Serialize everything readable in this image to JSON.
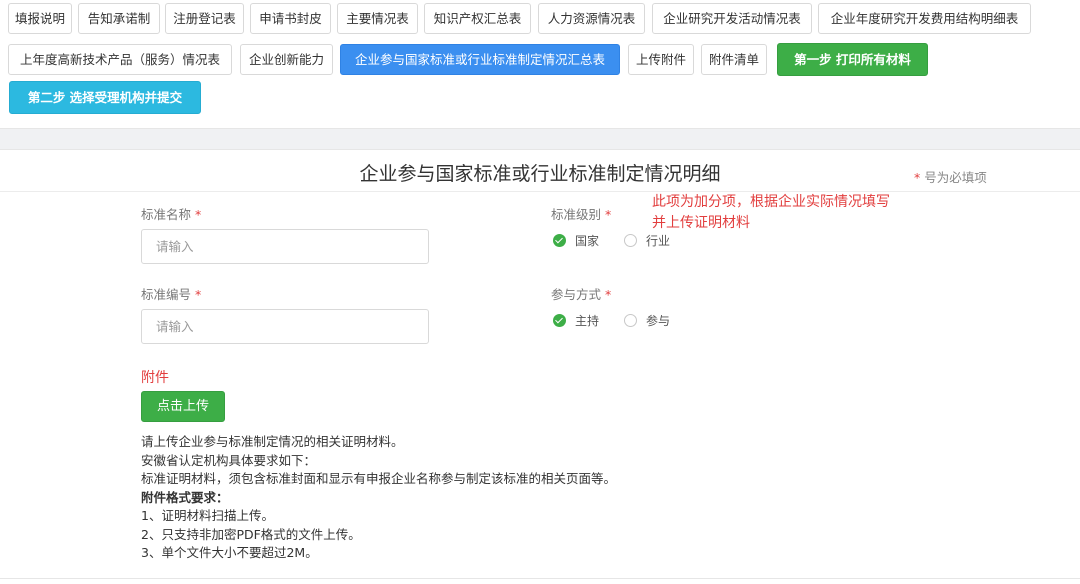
{
  "tabs": [
    {
      "label": "填报说明"
    },
    {
      "label": "告知承诺制"
    },
    {
      "label": "注册登记表"
    },
    {
      "label": "申请书封皮"
    },
    {
      "label": "主要情况表"
    },
    {
      "label": "知识产权汇总表"
    },
    {
      "label": "人力资源情况表"
    },
    {
      "label": "企业研究开发活动情况表"
    },
    {
      "label": "企业年度研究开发费用结构明细表"
    },
    {
      "label": "上年度高新技术产品（服务）情况表"
    },
    {
      "label": "企业创新能力"
    },
    {
      "label": "企业参与国家标准或行业标准制定情况汇总表"
    },
    {
      "label": "上传附件"
    },
    {
      "label": "附件清单"
    }
  ],
  "active_tab_index": 11,
  "actions": {
    "step1_label": "第一步 打印所有材料",
    "step2_label": "第二步 选择受理机构并提交"
  },
  "form": {
    "title": "企业参与国家标准或行业标准制定情况明细",
    "required_note_star": "*",
    "required_note_text": " 号为必填项",
    "standard_name": {
      "label": "标准名称",
      "star": " *",
      "placeholder": "请输入",
      "value": ""
    },
    "standard_number": {
      "label": "标准编号",
      "star": " *",
      "placeholder": "请输入",
      "value": ""
    },
    "standard_level": {
      "label": "标准级别",
      "star": " *",
      "options": [
        "国家",
        "行业"
      ],
      "selected": "国家"
    },
    "participation": {
      "label": "参与方式",
      "star": " *",
      "options": [
        "主持",
        "参与"
      ],
      "selected": "主持"
    }
  },
  "annotation": {
    "line1": "此项为加分项，根据企业实际情况填写",
    "line2": "并上传证明材料"
  },
  "attachment": {
    "label": "附件",
    "upload_button": "点击上传",
    "help_lines": [
      "请上传企业参与标准制定情况的相关证明材料。",
      "安徽省认定机构具体要求如下：",
      "标准证明材料，须包含标准封面和显示有申报企业名称参与制定该标准的相关页面等。"
    ],
    "format_title": "附件格式要求：",
    "format_rules": [
      "1、证明材料扫描上传。",
      "2、只支持非加密PDF格式的文件上传。",
      "3、单个文件大小不要超过2M。"
    ]
  },
  "colors": {
    "active_tab": "#3b8ff0",
    "green": "#3dae47",
    "cyan": "#2cb9e0",
    "required_red": "#e23e3e"
  }
}
